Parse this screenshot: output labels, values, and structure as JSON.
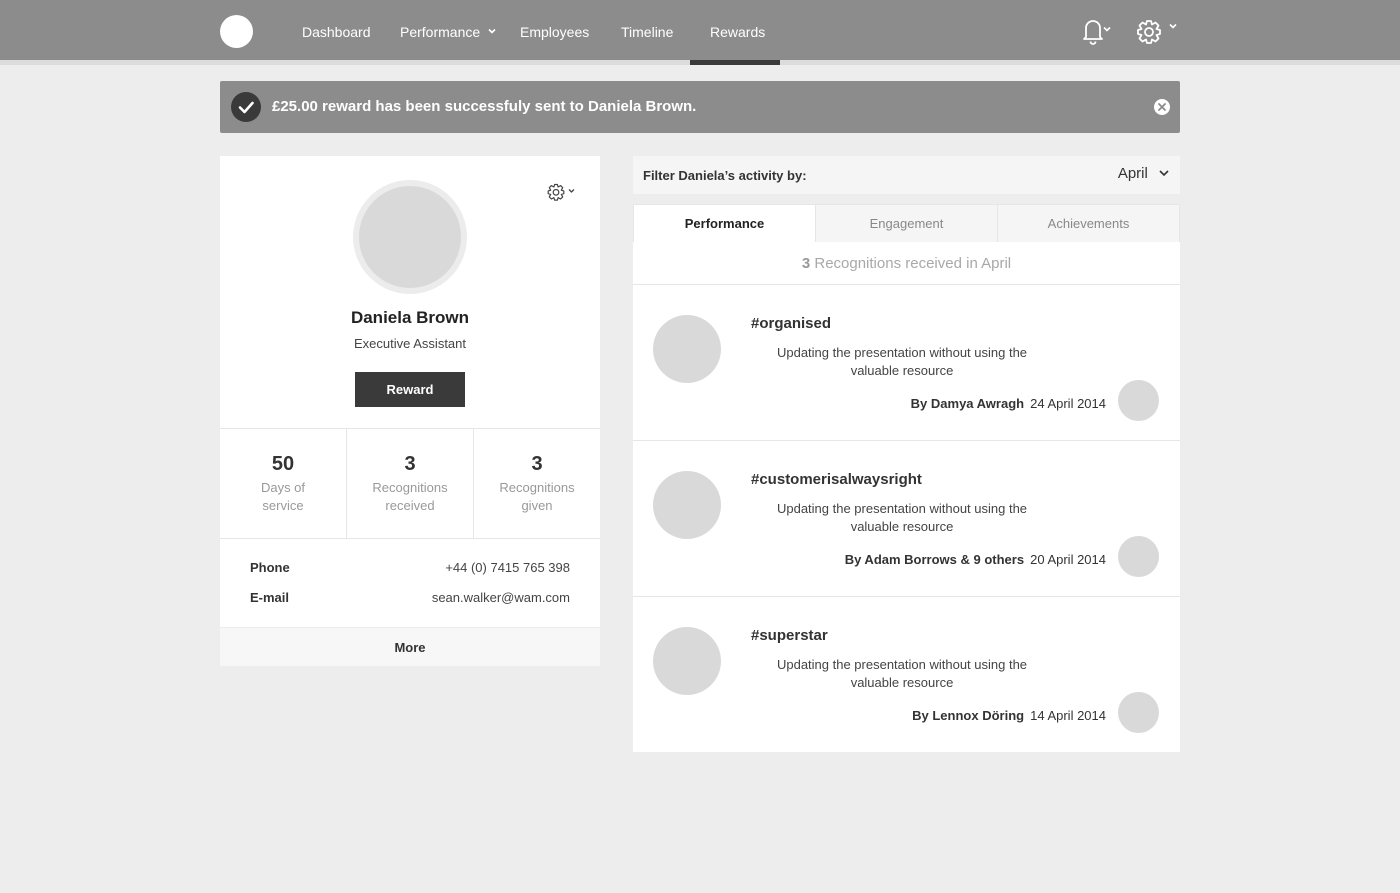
{
  "nav": {
    "links": [
      "Dashboard",
      "Performance",
      "Employees",
      "Timeline",
      "Rewards"
    ],
    "active": "Rewards",
    "icons": [
      "bell-icon",
      "gear-icon"
    ]
  },
  "alert": {
    "message": "£25.00 reward has been successfuly sent to Daniela Brown."
  },
  "profile": {
    "name": "Daniela Brown",
    "role": "Executive Assistant",
    "reward_label": "Reward",
    "stats": [
      {
        "value": "50",
        "label_line1": "Days of",
        "label_line2": "service"
      },
      {
        "value": "3",
        "label_line1": "Recognitions",
        "label_line2": "received"
      },
      {
        "value": "3",
        "label_line1": "Recognitions",
        "label_line2": "given"
      }
    ],
    "contact": {
      "phone_label": "Phone",
      "phone": "+44 (0) 7415 765 398",
      "email_label": "E-mail",
      "email": "sean.walker@wam.com"
    },
    "more_label": "More"
  },
  "filter": {
    "label": "Filter Daniela’s activity by:",
    "selected": "April"
  },
  "tabs": [
    "Performance",
    "Engagement",
    "Achievements"
  ],
  "feed": {
    "count": "3",
    "summary": "Recognitions received in April",
    "items": [
      {
        "tag": "#organised",
        "description": "Updating the presentation without using the valuable resource",
        "by": "By Damya Awragh",
        "date": "24 April 2014"
      },
      {
        "tag": "#customerisalwaysright",
        "description": "Updating the presentation without using the valuable resource",
        "by": "By Adam Borrows & 9 others",
        "date": "20 April 2014"
      },
      {
        "tag": "#superstar",
        "description": "Updating the presentation without using the valuable resource",
        "by": "By Lennox Döring",
        "date": "14 April 2014"
      }
    ]
  },
  "colors": {
    "topbar": "#8c8c8c",
    "dark": "#3a3a3a",
    "background": "#ededee",
    "placeholder": "#d9d9d9"
  }
}
